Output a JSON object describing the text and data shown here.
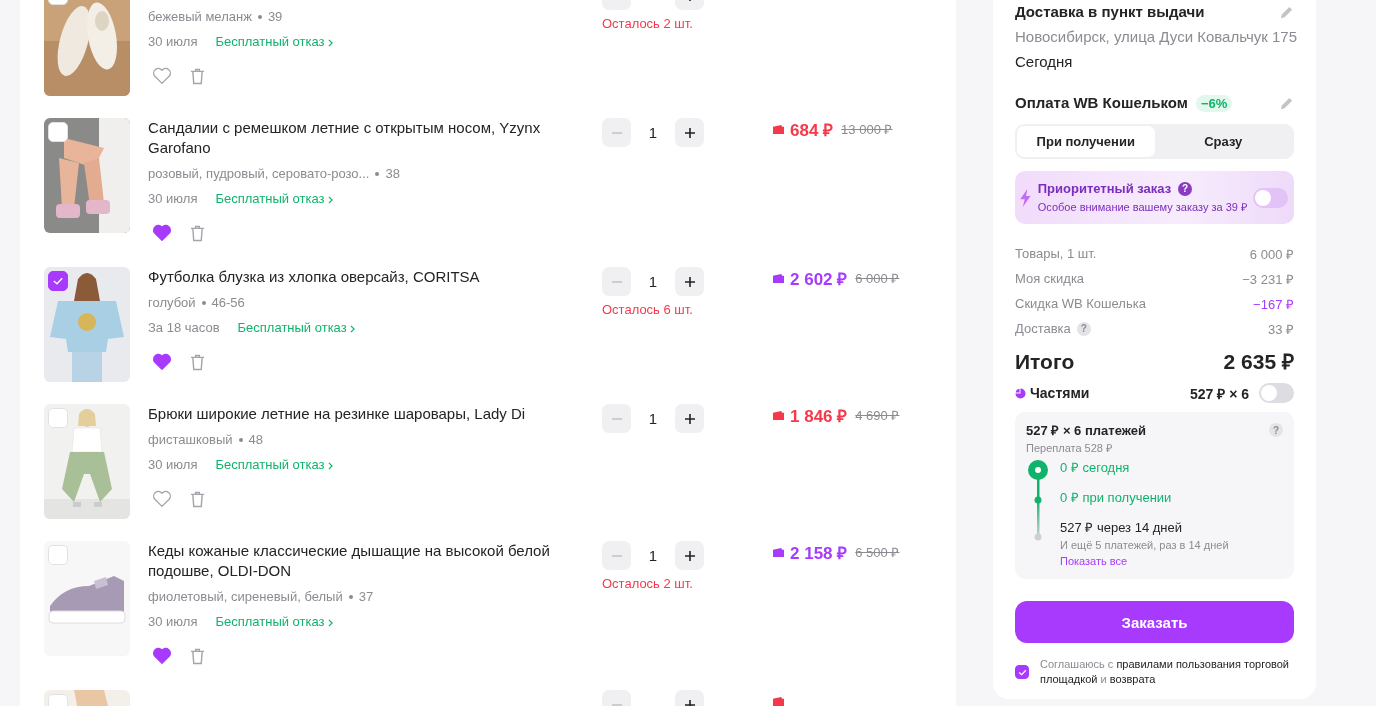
{
  "items": [
    {
      "checked": false,
      "variant": "бежевый меланж",
      "size": "39",
      "date": "30 июля",
      "refusal": "Бесплатный отказ",
      "favorite": false,
      "stock": "Осталось 2 шт."
    },
    {
      "checked": false,
      "title": "Сандалии с ремешком летние с открытым носом, Yzynx Garofano",
      "variant": "розовый, пудровый, серовато-розо...",
      "size": "38",
      "date": "30 июля",
      "refusal": "Бесплатный отказ",
      "favorite": true,
      "qty": "1",
      "can_decrease": false,
      "price": "684 ₽",
      "old_price": "13 000 ₽",
      "color": "#f5394b"
    },
    {
      "checked": true,
      "title": "Футболка блузка из хлопка оверсайз, CORITSA",
      "variant": "голубой",
      "size": "46-56",
      "date": "За 18 часов",
      "refusal": "Бесплатный отказ",
      "favorite": true,
      "qty": "1",
      "can_decrease": false,
      "stock": "Осталось 6 шт.",
      "price": "2 602 ₽",
      "old_price": "6 000 ₽",
      "color": "#a73afd"
    },
    {
      "checked": false,
      "title": "Брюки широкие летние на резинке шаровары, Lady Di",
      "variant": "фисташковый",
      "size": "48",
      "date": "30 июля",
      "refusal": "Бесплатный отказ",
      "favorite": false,
      "qty": "1",
      "can_decrease": false,
      "price": "1 846 ₽",
      "old_price": "4 690 ₽",
      "color": "#f5394b"
    },
    {
      "checked": false,
      "title": "Кеды кожаные классические дышащие на высокой белой подошве, OLDI-DON",
      "variant": "фиолетовый, сиреневый, белый",
      "size": "37",
      "date": "30 июля",
      "refusal": "Бесплатный отказ",
      "favorite": true,
      "qty": "1",
      "can_decrease": false,
      "stock": "Осталось 2 шт.",
      "price": "2 158 ₽",
      "old_price": "6 500 ₽",
      "color": "#a73afd"
    },
    {
      "checked": false,
      "can_decrease": false,
      "color": "#f5394b"
    }
  ],
  "delivery": {
    "title": "Доставка в пункт выдачи",
    "address": "Новосибирск, улица Дуси Ковальчук 175",
    "date": "Сегодня"
  },
  "payment": {
    "title": "Оплата WB Кошельком",
    "discount": "−6%",
    "tabs": [
      {
        "label": "При получении",
        "selected": true
      },
      {
        "label": "Сразу",
        "selected": false
      }
    ]
  },
  "priority": {
    "title": "Приоритетный заказ",
    "help": "?",
    "subtitle": "Особое внимание вашему заказу за 39 ₽",
    "on": false
  },
  "summary": [
    {
      "label": "Товары, 1 шт.",
      "value": "6 000 ₽",
      "highlight": false
    },
    {
      "label": "Моя скидка",
      "value": "−3 231 ₽",
      "highlight": false
    },
    {
      "label": "Скидка WB Кошелька",
      "value": "−167 ₽",
      "highlight": true
    },
    {
      "label": "Доставка",
      "help": "?",
      "value": "33 ₽",
      "highlight": false
    }
  ],
  "total": {
    "label": "Итого",
    "value": "2 635 ₽"
  },
  "installments": {
    "label": "Частями",
    "amount": "527 ₽ × 6",
    "on": false,
    "plan_title": "527 ₽ × 6 платежей",
    "help": "?",
    "overpay": "Переплата 528 ₽",
    "steps": [
      {
        "text": "0 ₽ сегодня",
        "done": true
      },
      {
        "text": "0 ₽ при получении",
        "done": true
      },
      {
        "text": "527 ₽ через 14 дней",
        "done": false
      }
    ],
    "note": "И ещё 5 платежей, раз в 14 дней",
    "link": "Показать все"
  },
  "order_button": "Заказать",
  "agreement": {
    "checked": true,
    "parts": [
      {
        "text": "Соглашаюсь с ",
        "link": false
      },
      {
        "text": "правилами пользования торговой площадкой",
        "link": true
      },
      {
        "text": " и ",
        "link": false
      },
      {
        "text": "возврата",
        "link": true
      }
    ]
  }
}
